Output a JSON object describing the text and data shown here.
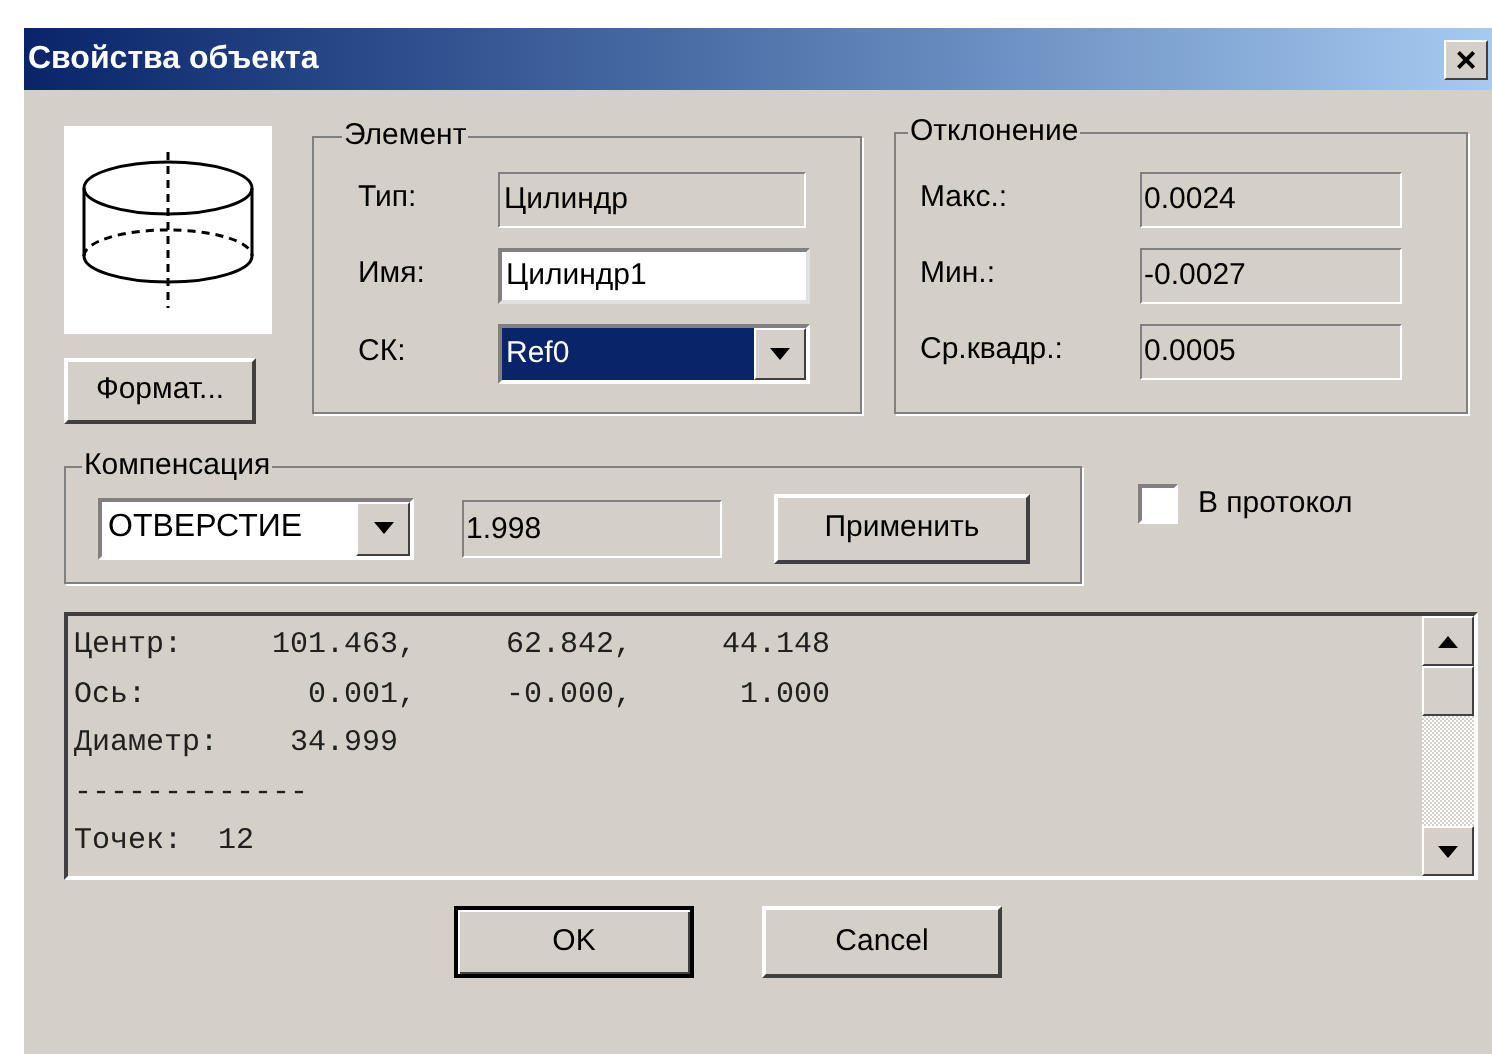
{
  "window": {
    "title": "Свойства объекта",
    "close": "×"
  },
  "format_button": "Формат...",
  "element": {
    "title": "Элемент",
    "fields": [
      {
        "label": "Тип:",
        "value": "Цилиндр",
        "kind": "readonly"
      },
      {
        "label": "Имя:",
        "value": "Цилиндр1",
        "kind": "text"
      },
      {
        "label": "СК:",
        "value": "Ref0",
        "kind": "combo",
        "highlighted": true
      }
    ]
  },
  "deviation": {
    "title": "Отклонение",
    "fields": [
      {
        "label": "Макс.:",
        "value": "0.0024"
      },
      {
        "label": "Мин.:",
        "value": "-0.0027"
      },
      {
        "label": "Ср.квадр.:",
        "value": "0.0005"
      }
    ]
  },
  "compensation": {
    "title": "Компенсация",
    "mode": "ОТВЕРСТИЕ",
    "value": "1.998",
    "apply_button": "Применить"
  },
  "protocol_checkbox": {
    "label": "В протокол",
    "checked": false
  },
  "report_lines": [
    "Центр:     101.463,     62.842,     44.148",
    "Ось:         0.001,     -0.000,      1.000",
    "Диаметр:    34.999",
    "-------------",
    "Точек:  12"
  ],
  "buttons": [
    {
      "label": "OK",
      "default": true
    },
    {
      "label": "Cancel",
      "default": false
    }
  ]
}
